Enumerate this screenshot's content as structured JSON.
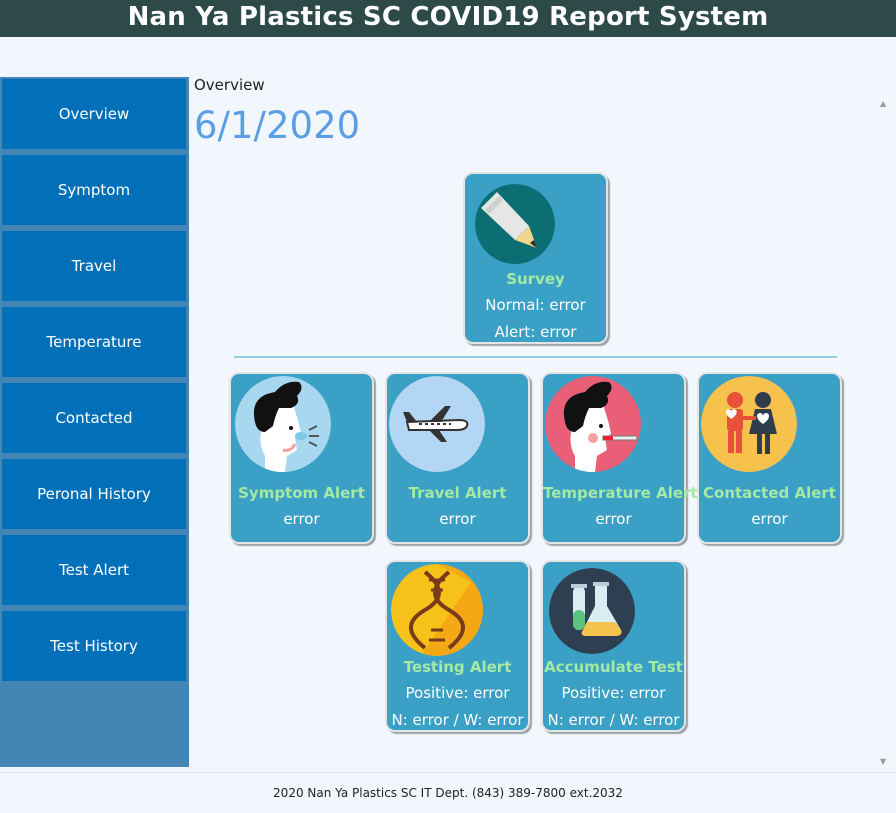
{
  "app": {
    "title": "Nan Ya Plastics SC COVID19 Report System"
  },
  "sidebar": {
    "items": [
      {
        "label": "Overview"
      },
      {
        "label": "Symptom"
      },
      {
        "label": "Travel"
      },
      {
        "label": "Temperature"
      },
      {
        "label": "Contacted"
      },
      {
        "label": "Peronal History"
      },
      {
        "label": "Test Alert"
      },
      {
        "label": "Test History"
      }
    ]
  },
  "main": {
    "breadcrumb": "Overview",
    "date": "6/1/2020",
    "cards": {
      "survey": {
        "title": "Survey",
        "line1": "Normal: error",
        "line2": "Alert: error"
      },
      "symptom": {
        "title": "Symptom Alert",
        "line1": "error"
      },
      "travel": {
        "title": "Travel Alert",
        "line1": "error"
      },
      "temperature": {
        "title": "Temperature Alert",
        "line1": "error"
      },
      "contacted": {
        "title": "Contacted Alert",
        "line1": "error"
      },
      "testing": {
        "title": "Testing Alert",
        "line1": "Positive: error",
        "line2": "N: error / W: error"
      },
      "accumulate": {
        "title": "Accumulate Test",
        "line1": "Positive: error",
        "line2": "N: error / W: error"
      }
    }
  },
  "footer": {
    "text": "2020 Nan Ya Plastics SC IT Dept. (843) 389-7800 ext.2032"
  },
  "colors": {
    "header_bg": "#2d4a48",
    "nav_item": "#0270b9",
    "card_bg": "#3aa0c6",
    "card_title": "#a4e9a4",
    "date": "#5b9ee6"
  }
}
